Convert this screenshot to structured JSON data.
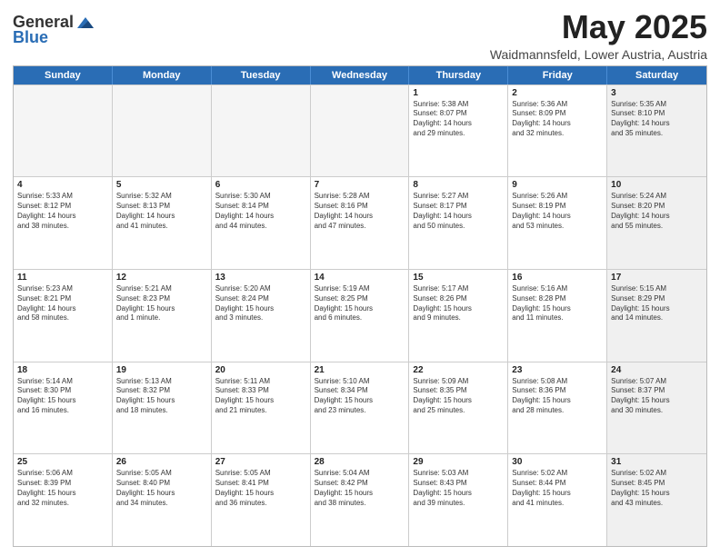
{
  "logo": {
    "general": "General",
    "blue": "Blue"
  },
  "title": "May 2025",
  "location": "Waidmannsfeld, Lower Austria, Austria",
  "headers": [
    "Sunday",
    "Monday",
    "Tuesday",
    "Wednesday",
    "Thursday",
    "Friday",
    "Saturday"
  ],
  "weeks": [
    [
      {
        "day": "",
        "text": "",
        "shaded": true
      },
      {
        "day": "",
        "text": "",
        "shaded": true
      },
      {
        "day": "",
        "text": "",
        "shaded": true
      },
      {
        "day": "",
        "text": "",
        "shaded": true
      },
      {
        "day": "1",
        "text": "Sunrise: 5:38 AM\nSunset: 8:07 PM\nDaylight: 14 hours\nand 29 minutes.",
        "shaded": false
      },
      {
        "day": "2",
        "text": "Sunrise: 5:36 AM\nSunset: 8:09 PM\nDaylight: 14 hours\nand 32 minutes.",
        "shaded": false
      },
      {
        "day": "3",
        "text": "Sunrise: 5:35 AM\nSunset: 8:10 PM\nDaylight: 14 hours\nand 35 minutes.",
        "shaded": true
      }
    ],
    [
      {
        "day": "4",
        "text": "Sunrise: 5:33 AM\nSunset: 8:12 PM\nDaylight: 14 hours\nand 38 minutes.",
        "shaded": false
      },
      {
        "day": "5",
        "text": "Sunrise: 5:32 AM\nSunset: 8:13 PM\nDaylight: 14 hours\nand 41 minutes.",
        "shaded": false
      },
      {
        "day": "6",
        "text": "Sunrise: 5:30 AM\nSunset: 8:14 PM\nDaylight: 14 hours\nand 44 minutes.",
        "shaded": false
      },
      {
        "day": "7",
        "text": "Sunrise: 5:28 AM\nSunset: 8:16 PM\nDaylight: 14 hours\nand 47 minutes.",
        "shaded": false
      },
      {
        "day": "8",
        "text": "Sunrise: 5:27 AM\nSunset: 8:17 PM\nDaylight: 14 hours\nand 50 minutes.",
        "shaded": false
      },
      {
        "day": "9",
        "text": "Sunrise: 5:26 AM\nSunset: 8:19 PM\nDaylight: 14 hours\nand 53 minutes.",
        "shaded": false
      },
      {
        "day": "10",
        "text": "Sunrise: 5:24 AM\nSunset: 8:20 PM\nDaylight: 14 hours\nand 55 minutes.",
        "shaded": true
      }
    ],
    [
      {
        "day": "11",
        "text": "Sunrise: 5:23 AM\nSunset: 8:21 PM\nDaylight: 14 hours\nand 58 minutes.",
        "shaded": false
      },
      {
        "day": "12",
        "text": "Sunrise: 5:21 AM\nSunset: 8:23 PM\nDaylight: 15 hours\nand 1 minute.",
        "shaded": false
      },
      {
        "day": "13",
        "text": "Sunrise: 5:20 AM\nSunset: 8:24 PM\nDaylight: 15 hours\nand 3 minutes.",
        "shaded": false
      },
      {
        "day": "14",
        "text": "Sunrise: 5:19 AM\nSunset: 8:25 PM\nDaylight: 15 hours\nand 6 minutes.",
        "shaded": false
      },
      {
        "day": "15",
        "text": "Sunrise: 5:17 AM\nSunset: 8:26 PM\nDaylight: 15 hours\nand 9 minutes.",
        "shaded": false
      },
      {
        "day": "16",
        "text": "Sunrise: 5:16 AM\nSunset: 8:28 PM\nDaylight: 15 hours\nand 11 minutes.",
        "shaded": false
      },
      {
        "day": "17",
        "text": "Sunrise: 5:15 AM\nSunset: 8:29 PM\nDaylight: 15 hours\nand 14 minutes.",
        "shaded": true
      }
    ],
    [
      {
        "day": "18",
        "text": "Sunrise: 5:14 AM\nSunset: 8:30 PM\nDaylight: 15 hours\nand 16 minutes.",
        "shaded": false
      },
      {
        "day": "19",
        "text": "Sunrise: 5:13 AM\nSunset: 8:32 PM\nDaylight: 15 hours\nand 18 minutes.",
        "shaded": false
      },
      {
        "day": "20",
        "text": "Sunrise: 5:11 AM\nSunset: 8:33 PM\nDaylight: 15 hours\nand 21 minutes.",
        "shaded": false
      },
      {
        "day": "21",
        "text": "Sunrise: 5:10 AM\nSunset: 8:34 PM\nDaylight: 15 hours\nand 23 minutes.",
        "shaded": false
      },
      {
        "day": "22",
        "text": "Sunrise: 5:09 AM\nSunset: 8:35 PM\nDaylight: 15 hours\nand 25 minutes.",
        "shaded": false
      },
      {
        "day": "23",
        "text": "Sunrise: 5:08 AM\nSunset: 8:36 PM\nDaylight: 15 hours\nand 28 minutes.",
        "shaded": false
      },
      {
        "day": "24",
        "text": "Sunrise: 5:07 AM\nSunset: 8:37 PM\nDaylight: 15 hours\nand 30 minutes.",
        "shaded": true
      }
    ],
    [
      {
        "day": "25",
        "text": "Sunrise: 5:06 AM\nSunset: 8:39 PM\nDaylight: 15 hours\nand 32 minutes.",
        "shaded": false
      },
      {
        "day": "26",
        "text": "Sunrise: 5:05 AM\nSunset: 8:40 PM\nDaylight: 15 hours\nand 34 minutes.",
        "shaded": false
      },
      {
        "day": "27",
        "text": "Sunrise: 5:05 AM\nSunset: 8:41 PM\nDaylight: 15 hours\nand 36 minutes.",
        "shaded": false
      },
      {
        "day": "28",
        "text": "Sunrise: 5:04 AM\nSunset: 8:42 PM\nDaylight: 15 hours\nand 38 minutes.",
        "shaded": false
      },
      {
        "day": "29",
        "text": "Sunrise: 5:03 AM\nSunset: 8:43 PM\nDaylight: 15 hours\nand 39 minutes.",
        "shaded": false
      },
      {
        "day": "30",
        "text": "Sunrise: 5:02 AM\nSunset: 8:44 PM\nDaylight: 15 hours\nand 41 minutes.",
        "shaded": false
      },
      {
        "day": "31",
        "text": "Sunrise: 5:02 AM\nSunset: 8:45 PM\nDaylight: 15 hours\nand 43 minutes.",
        "shaded": true
      }
    ]
  ]
}
